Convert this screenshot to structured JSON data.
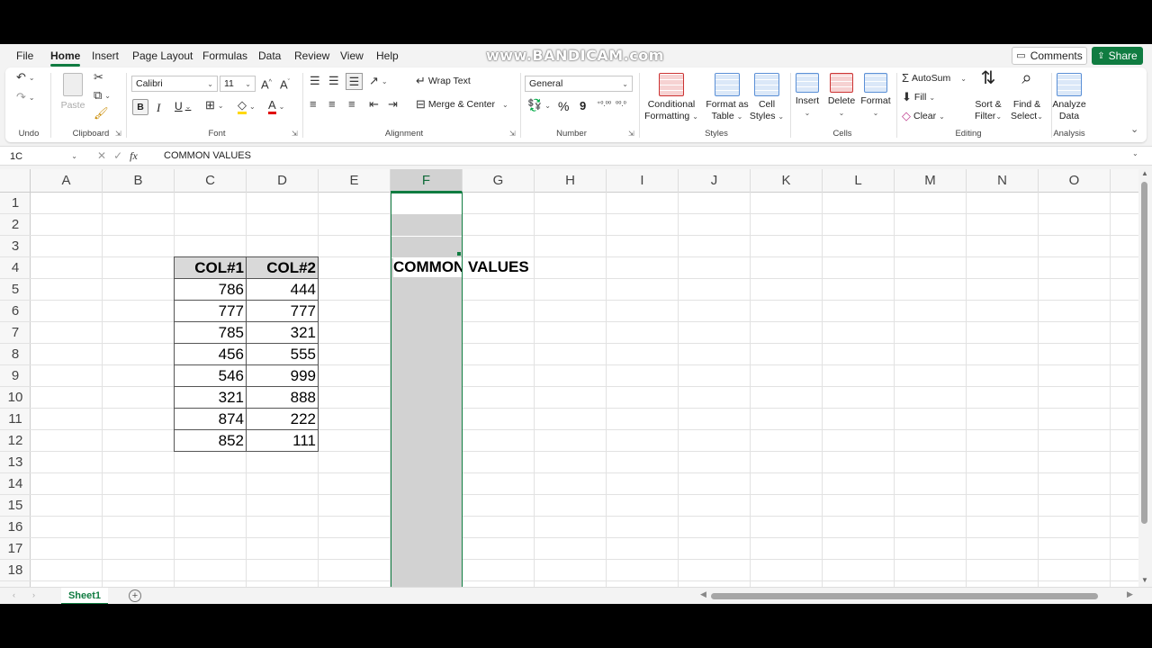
{
  "watermark": "www.BANDICAM.com",
  "menu": {
    "items": [
      "File",
      "Home",
      "Insert",
      "Page Layout",
      "Formulas",
      "Data",
      "Review",
      "View",
      "Help"
    ],
    "active": "Home",
    "comments_label": "Comments",
    "share_label": "Share"
  },
  "ribbon": {
    "undo": {
      "label": "Undo"
    },
    "clipboard": {
      "paste_label": "Paste",
      "label": "Clipboard"
    },
    "font": {
      "name": "Calibri",
      "size": "11",
      "label": "Font",
      "bold": "B",
      "italic": "I",
      "underline": "U"
    },
    "alignment": {
      "wrap_text": "Wrap Text",
      "merge_center": "Merge & Center",
      "label": "Alignment"
    },
    "number": {
      "format": "General",
      "label": "Number",
      "percent": "%",
      "comma": "9"
    },
    "styles": {
      "conditional": [
        "Conditional",
        "Formatting"
      ],
      "format_table": [
        "Format as",
        "Table"
      ],
      "cell_styles": [
        "Cell",
        "Styles"
      ],
      "label": "Styles"
    },
    "cells": {
      "insert": "Insert",
      "delete": "Delete",
      "format": "Format",
      "label": "Cells"
    },
    "editing": {
      "autosum": "AutoSum",
      "fill": "Fill",
      "clear": "Clear",
      "sort_filter": [
        "Sort &",
        "Filter"
      ],
      "find_select": [
        "Find &",
        "Select"
      ],
      "label": "Editing"
    },
    "analysis": {
      "analyze": [
        "Analyze",
        "Data"
      ],
      "label": "Analysis"
    }
  },
  "formula_bar": {
    "name_box": "1C",
    "fx": "fx",
    "content": "COMMON VALUES"
  },
  "grid": {
    "columns": [
      "A",
      "B",
      "C",
      "D",
      "E",
      "F",
      "G",
      "H",
      "I",
      "J",
      "K",
      "L",
      "M",
      "N",
      "O"
    ],
    "selected_column": "F",
    "rows": [
      "1",
      "2",
      "3",
      "4",
      "5",
      "6",
      "7",
      "8",
      "9",
      "10",
      "11",
      "12",
      "13",
      "14",
      "15",
      "16",
      "17",
      "18"
    ],
    "table": {
      "headers": [
        "COL#1",
        "COL#2"
      ],
      "rows": [
        [
          "786",
          "444"
        ],
        [
          "777",
          "777"
        ],
        [
          "785",
          "321"
        ],
        [
          "456",
          "555"
        ],
        [
          "546",
          "999"
        ],
        [
          "321",
          "888"
        ],
        [
          "874",
          "222"
        ],
        [
          "852",
          "111"
        ]
      ]
    },
    "f2_text": "COMMON",
    "g2_text": "VALUES"
  },
  "sheet_tabs": {
    "active": "Sheet1",
    "add": "+"
  }
}
